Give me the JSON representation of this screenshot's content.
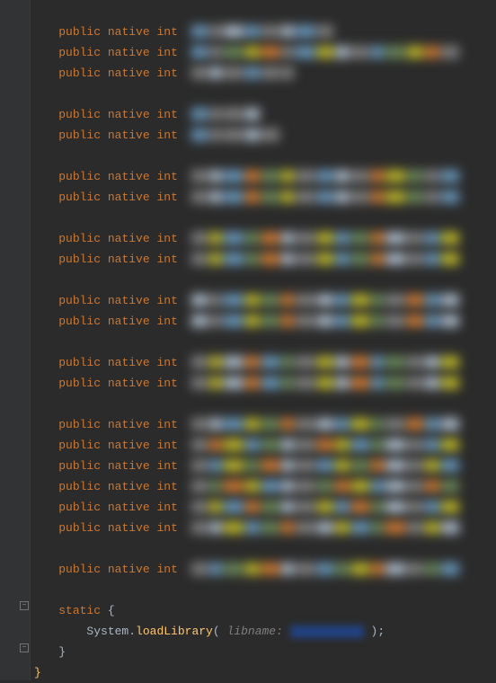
{
  "declarations": [
    {
      "modifiers": "public native",
      "type": "int",
      "blur": [
        "bl",
        "gr",
        "w",
        "bl",
        "gr",
        "w",
        "bl",
        "gr"
      ]
    },
    {
      "modifiers": "public native",
      "type": "int",
      "blur": [
        "bl",
        "gr",
        "g",
        "y",
        "o",
        "gr",
        "bl",
        "y",
        "w",
        "gr",
        "bl",
        "g",
        "y",
        "o",
        "gr"
      ]
    },
    {
      "modifiers": "public native",
      "type": "int",
      "blur": [
        "gr",
        "w",
        "gr",
        "bl",
        "gr",
        "gr"
      ]
    }
  ],
  "group2": [
    {
      "modifiers": "public native",
      "type": "int",
      "blur": [
        "bl",
        "gr",
        "gr",
        "w"
      ]
    },
    {
      "modifiers": "public native",
      "type": "int",
      "blur": [
        "bl",
        "gr",
        "gr",
        "w",
        "gr"
      ]
    }
  ],
  "group3": [
    {
      "modifiers": "public native",
      "type": "int",
      "blur": [
        "gr",
        "w",
        "bl",
        "o",
        "g",
        "y",
        "gr",
        "bl",
        "w",
        "gr",
        "o",
        "y",
        "g",
        "gr",
        "bl"
      ]
    },
    {
      "modifiers": "public native",
      "type": "int",
      "blur": [
        "gr",
        "w",
        "bl",
        "o",
        "g",
        "y",
        "gr",
        "bl",
        "w",
        "gr",
        "o",
        "y",
        "g",
        "gr",
        "bl"
      ]
    }
  ],
  "group4": [
    {
      "modifiers": "public native",
      "type": "int",
      "blur": [
        "gr",
        "y",
        "bl",
        "g",
        "o",
        "w",
        "gr",
        "y",
        "bl",
        "g",
        "o",
        "w",
        "gr",
        "bl",
        "y"
      ]
    },
    {
      "modifiers": "public native",
      "type": "int",
      "blur": [
        "gr",
        "y",
        "bl",
        "g",
        "o",
        "w",
        "gr",
        "y",
        "bl",
        "g",
        "o",
        "w",
        "gr",
        "bl",
        "y"
      ]
    }
  ],
  "group5": [
    {
      "modifiers": "public native",
      "type": "int",
      "blur": [
        "w",
        "gr",
        "bl",
        "y",
        "g",
        "o",
        "gr",
        "w",
        "bl",
        "y",
        "g",
        "gr",
        "o",
        "bl",
        "w"
      ]
    },
    {
      "modifiers": "public native",
      "type": "int",
      "blur": [
        "w",
        "gr",
        "bl",
        "y",
        "g",
        "o",
        "gr",
        "w",
        "bl",
        "y",
        "g",
        "gr",
        "o",
        "bl",
        "w"
      ]
    }
  ],
  "group6": [
    {
      "modifiers": "public native",
      "type": "int",
      "blur": [
        "gr",
        "y",
        "w",
        "o",
        "bl",
        "g",
        "gr",
        "y",
        "w",
        "o",
        "bl",
        "g",
        "gr",
        "w",
        "y"
      ]
    },
    {
      "modifiers": "public native",
      "type": "int",
      "blur": [
        "gr",
        "y",
        "w",
        "o",
        "bl",
        "g",
        "gr",
        "y",
        "w",
        "o",
        "bl",
        "g",
        "gr",
        "w",
        "y"
      ]
    }
  ],
  "group7": [
    {
      "modifiers": "public native",
      "type": "int",
      "blur": [
        "gr",
        "w",
        "bl",
        "y",
        "g",
        "o",
        "gr",
        "w",
        "bl",
        "y",
        "g",
        "gr",
        "o",
        "bl",
        "w"
      ]
    },
    {
      "modifiers": "public native",
      "type": "int",
      "blur": [
        "gr",
        "o",
        "y",
        "bl",
        "g",
        "w",
        "gr",
        "o",
        "y",
        "bl",
        "g",
        "w",
        "gr",
        "bl",
        "y"
      ]
    },
    {
      "modifiers": "public native",
      "type": "int",
      "blur": [
        "gr",
        "bl",
        "y",
        "g",
        "o",
        "w",
        "gr",
        "bl",
        "y",
        "g",
        "o",
        "w",
        "gr",
        "y",
        "bl"
      ]
    },
    {
      "modifiers": "public native",
      "type": "int",
      "blur": [
        "gr",
        "g",
        "o",
        "y",
        "bl",
        "w",
        "gr",
        "g",
        "o",
        "y",
        "bl",
        "w",
        "gr",
        "o",
        "g"
      ]
    },
    {
      "modifiers": "public native",
      "type": "int",
      "blur": [
        "gr",
        "y",
        "bl",
        "o",
        "g",
        "w",
        "gr",
        "y",
        "bl",
        "o",
        "g",
        "w",
        "gr",
        "bl",
        "y"
      ]
    },
    {
      "modifiers": "public native",
      "type": "int",
      "blur": [
        "gr",
        "w",
        "y",
        "bl",
        "g",
        "o",
        "gr",
        "w",
        "y",
        "bl",
        "g",
        "o",
        "gr",
        "y",
        "w"
      ]
    }
  ],
  "group8": [
    {
      "modifiers": "public native",
      "type": "int",
      "blur": [
        "gr",
        "bl",
        "g",
        "y",
        "o",
        "w",
        "gr",
        "bl",
        "g",
        "y",
        "o",
        "w",
        "gr",
        "g",
        "bl"
      ]
    }
  ],
  "static_block": {
    "keyword": "static",
    "open": "{",
    "call_obj": "System",
    "call_method": "loadLibrary",
    "param_hint": "libname:",
    "close_paren": ");",
    "close_brace": "}"
  },
  "final_brace": "}"
}
